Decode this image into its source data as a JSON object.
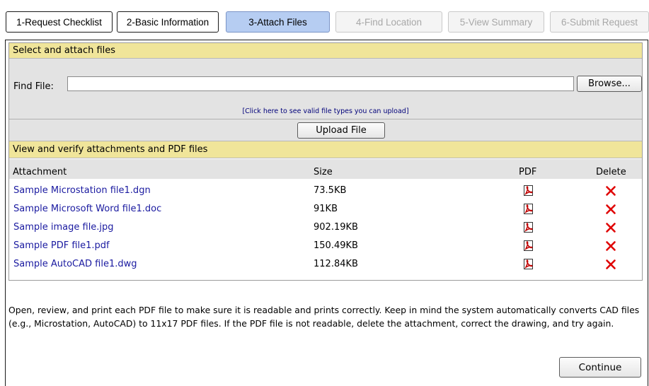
{
  "wizard": {
    "tabs": [
      {
        "label": "1-Request Checklist",
        "state": "done"
      },
      {
        "label": "2-Basic Information",
        "state": "done"
      },
      {
        "label": "3-Attach Files",
        "state": "current"
      },
      {
        "label": "4-Find Location",
        "state": "disabled"
      },
      {
        "label": "5-View Summary",
        "state": "disabled"
      },
      {
        "label": "6-Submit Request",
        "state": "disabled"
      }
    ]
  },
  "select_section": {
    "header": "Select and attach files",
    "find_label": "Find File:",
    "find_value": "",
    "browse_label": "Browse...",
    "valid_types_link": "[Click here to see valid file types you can upload]",
    "upload_label": "Upload File"
  },
  "attachments_section": {
    "header": "View and verify attachments and PDF files",
    "columns": {
      "attachment": "Attachment",
      "size": "Size",
      "pdf": "PDF",
      "delete": "Delete"
    },
    "rows": [
      {
        "name": "Sample Microstation file1.dgn",
        "size": "73.5KB"
      },
      {
        "name": "Sample Microsoft Word file1.doc",
        "size": "91KB"
      },
      {
        "name": "Sample image file.jpg",
        "size": "902.19KB"
      },
      {
        "name": "Sample PDF file1.pdf",
        "size": "150.49KB"
      },
      {
        "name": "Sample AutoCAD file1.dwg",
        "size": "112.84KB"
      }
    ]
  },
  "instructions": "Open, review, and print each PDF file to make sure it is readable and prints correctly. Keep in mind the system automatically converts CAD files (e.g., Microstation, AutoCAD) to 11x17 PDF files. If the PDF file is not readable, delete the attachment, correct the drawing, and try again.",
  "continue_label": "Continue",
  "colors": {
    "section_header": "#f0e59a",
    "current_tab": "#b6cdf2",
    "link": "#1a1aa0",
    "delete_red": "#e00000",
    "gray_area": "#e3e3e3"
  },
  "icons": {
    "pdf": "pdf-file-icon",
    "delete": "delete-x-icon"
  }
}
